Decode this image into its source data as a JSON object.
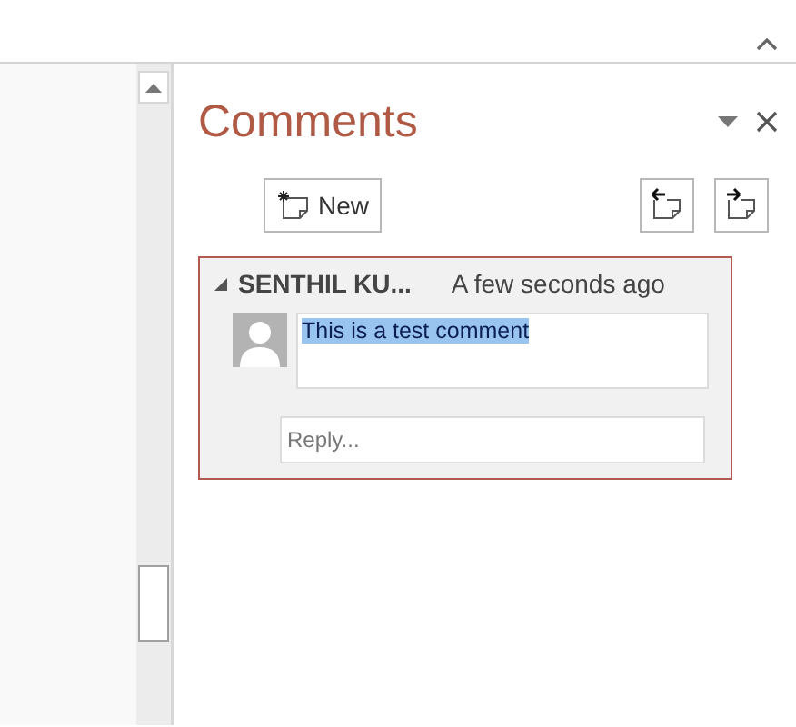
{
  "pane": {
    "title": "Comments",
    "new_button": "New"
  },
  "comments": [
    {
      "author": "SENTHIL KU...",
      "time": "A few seconds ago",
      "expanded": true,
      "text": "This is a test comment",
      "text_selected": true,
      "reply": {
        "placeholder": "Reply..."
      }
    }
  ]
}
